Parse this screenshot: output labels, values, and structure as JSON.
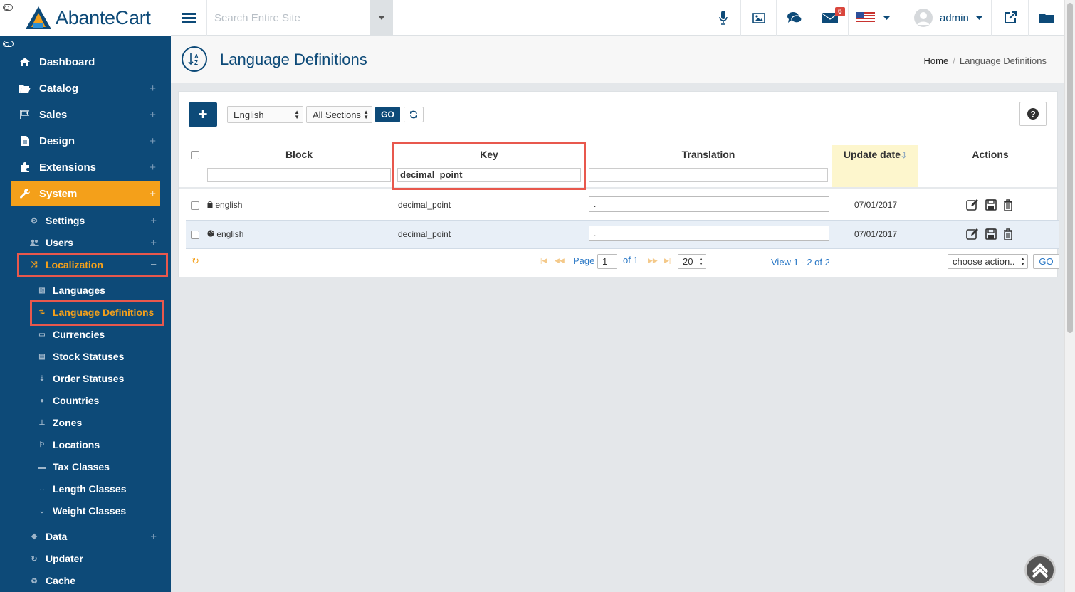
{
  "app": {
    "name": "AbanteCart"
  },
  "topbar": {
    "search_placeholder": "Search Entire Site",
    "messages_count": "6",
    "user_name": "admin"
  },
  "sidebar": {
    "top": [
      {
        "label": "Dashboard"
      },
      {
        "label": "Catalog"
      },
      {
        "label": "Sales"
      },
      {
        "label": "Design"
      },
      {
        "label": "Extensions"
      },
      {
        "label": "System"
      }
    ],
    "system_sub": [
      {
        "label": "Settings"
      },
      {
        "label": "Users"
      },
      {
        "label": "Localization"
      }
    ],
    "localization_items": [
      {
        "label": "Languages"
      },
      {
        "label": "Language Definitions"
      },
      {
        "label": "Currencies"
      },
      {
        "label": "Stock Statuses"
      },
      {
        "label": "Order Statuses"
      },
      {
        "label": "Countries"
      },
      {
        "label": "Zones"
      },
      {
        "label": "Locations"
      },
      {
        "label": "Tax Classes"
      },
      {
        "label": "Length Classes"
      },
      {
        "label": "Weight Classes"
      }
    ],
    "bottom_sub": [
      {
        "label": "Data"
      },
      {
        "label": "Updater"
      },
      {
        "label": "Cache"
      }
    ],
    "plus_sign": "+",
    "minus_sign": "−"
  },
  "page": {
    "title": "Language Definitions",
    "breadcrumb_home": "Home",
    "breadcrumb_separator": "/",
    "breadcrumb_current": "Language Definitions"
  },
  "toolbar": {
    "add_label": "+",
    "language_select": "English",
    "section_select": "All Sections",
    "go_label": "GO"
  },
  "grid": {
    "columns": {
      "block": "Block",
      "key": "Key",
      "translation": "Translation",
      "update_date": "Update date",
      "actions": "Actions"
    },
    "filters": {
      "block": "",
      "key": "decimal_point",
      "translation": ""
    },
    "rows": [
      {
        "block": "english",
        "key": "decimal_point",
        "translation": ".",
        "update_date": "07/01/2017"
      },
      {
        "block": "english",
        "key": "decimal_point",
        "translation": ".",
        "update_date": "07/01/2017"
      }
    ]
  },
  "pager": {
    "page_label": "Page",
    "page_value": "1",
    "of_label": "of 1",
    "per_page": "20",
    "view_text": "View 1 - 2 of 2",
    "choose_action": "choose action..",
    "go_label": "GO"
  },
  "colors": {
    "brand_blue": "#0d4a78",
    "active_orange": "#f4a01a",
    "highlight_red": "#e8584d"
  }
}
